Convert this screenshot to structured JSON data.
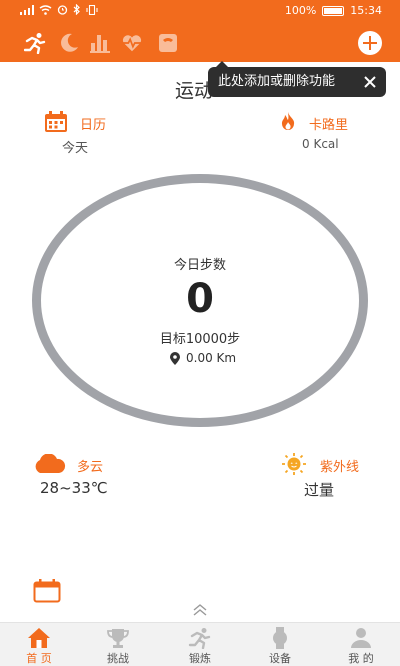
{
  "status_bar": {
    "battery": "100%",
    "time": "15:34"
  },
  "top_bar": {
    "tabs": [
      {
        "name": "run",
        "active": true
      },
      {
        "name": "sleep",
        "active": false
      },
      {
        "name": "stats",
        "active": false
      },
      {
        "name": "heart",
        "active": false
      },
      {
        "name": "weight",
        "active": false
      }
    ]
  },
  "page": {
    "title": "运动"
  },
  "tooltip": {
    "text": "此处添加或删除功能"
  },
  "calendar": {
    "label": "日历",
    "value": "今天"
  },
  "calories": {
    "label": "卡路里",
    "value": "0 Kcal"
  },
  "steps": {
    "title": "今日步数",
    "count": "0",
    "target": "目标10000步",
    "distance": "0.00 Km"
  },
  "weather": {
    "label": "多云",
    "value": "28~33℃"
  },
  "uv": {
    "label": "紫外线",
    "value": "过量"
  },
  "bottom_nav": {
    "items": [
      {
        "label": "首 页",
        "active": true
      },
      {
        "label": "挑战",
        "active": false
      },
      {
        "label": "锻炼",
        "active": false
      },
      {
        "label": "设备",
        "active": false
      },
      {
        "label": "我 的",
        "active": false
      }
    ]
  },
  "colors": {
    "accent": "#f26b1d",
    "ring": "#a1a3a8"
  }
}
